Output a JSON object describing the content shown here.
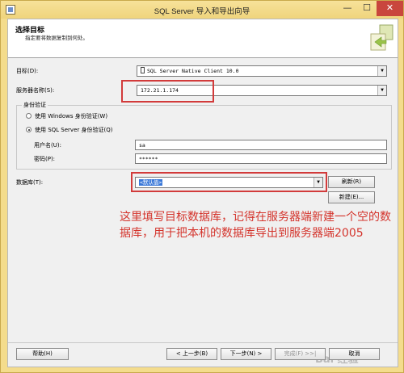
{
  "window": {
    "title": "SQL Server 导入和导出向导"
  },
  "header": {
    "title": "选择目标",
    "subtitle": "指定要将数据复制到何处。"
  },
  "destination": {
    "label": "目标(D):",
    "value": "SQL Server Native Client 10.0"
  },
  "server": {
    "label": "服务器名称(S):",
    "value": "172.21.1.174"
  },
  "auth": {
    "legend": "身份验证",
    "windows_label": "使用 Windows 身份验证(W)",
    "sql_label": "使用 SQL Server 身份验证(Q)",
    "user_label": "用户名(U):",
    "user_value": "sa",
    "password_label": "密码(P):",
    "password_value": "******"
  },
  "database": {
    "label": "数据库(T):",
    "value": "<默认值>",
    "refresh_label": "刷新(R)",
    "new_label": "新建(E)..."
  },
  "annotation": "这里填写目标数据库，记得在服务器端新建一个空的数据库，用于把本机的数据库导出到服务器端2005",
  "footer": {
    "help": "帮助(H)",
    "back": "< 上一步(B)",
    "next": "下一步(N) >",
    "finish": "完成(F) >>|",
    "cancel": "取消"
  },
  "watermark": "Bai 经验",
  "colors": {
    "annotation": "#d4342c",
    "highlight_box": "#d23b3b"
  },
  "icons": [
    "app-icon",
    "minimize-icon",
    "maximize-icon",
    "close-icon",
    "wizard-logo-icon",
    "server-icon",
    "chevron-down-icon"
  ]
}
